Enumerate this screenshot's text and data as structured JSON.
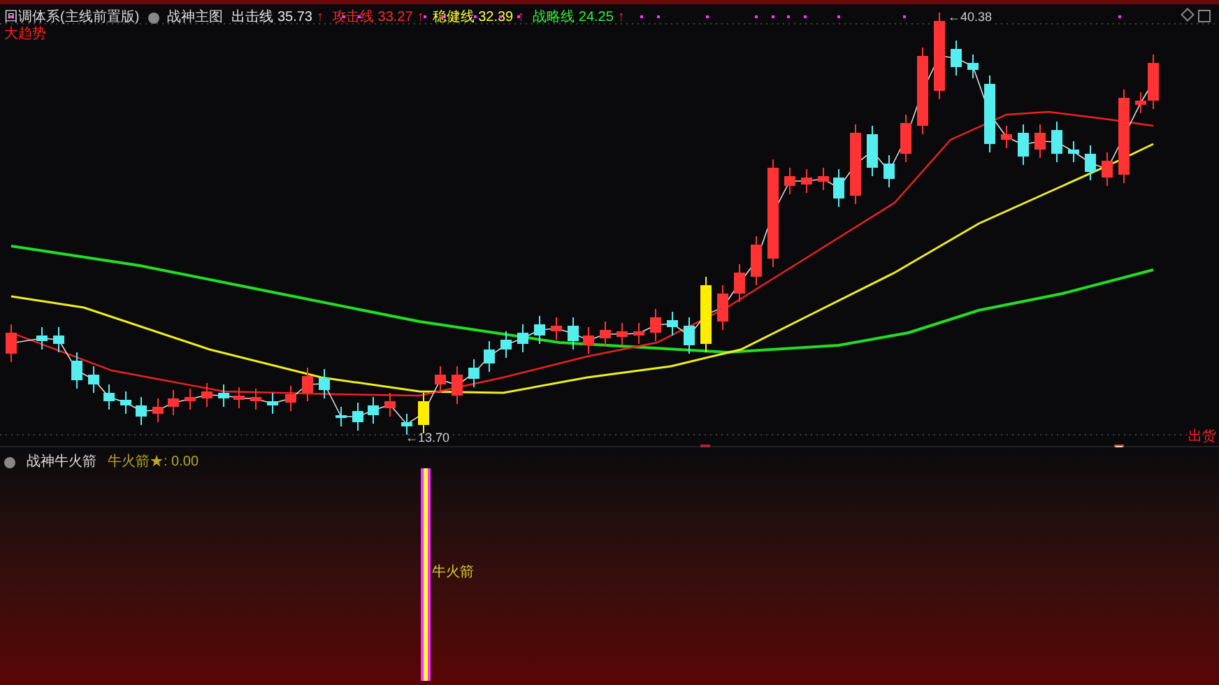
{
  "header": {
    "title": "回调体系(主线前置版)",
    "subtitle": "战神主图",
    "readings": [
      {
        "label": "出击线",
        "value": "35.73",
        "arrow": "↑",
        "color": "#e6e6e6"
      },
      {
        "label": "攻击线",
        "value": "33.27",
        "arrow": "↑",
        "color": "#ff2a2a"
      },
      {
        "label": "稳健线",
        "value": "32.39",
        "arrow": "↑",
        "color": "#ffff33"
      },
      {
        "label": "战略线",
        "value": "24.25",
        "arrow": "↑",
        "color": "#33ee33"
      }
    ]
  },
  "trend_label": "大趋势",
  "price_marks": {
    "high": "40.38",
    "low": "13.70",
    "arrow": "←"
  },
  "signal_tag": "出货",
  "sub_panel": {
    "title": "战神牛火箭",
    "reading": "牛火箭★: 0.00",
    "bar_label": "牛火箭"
  }
}
